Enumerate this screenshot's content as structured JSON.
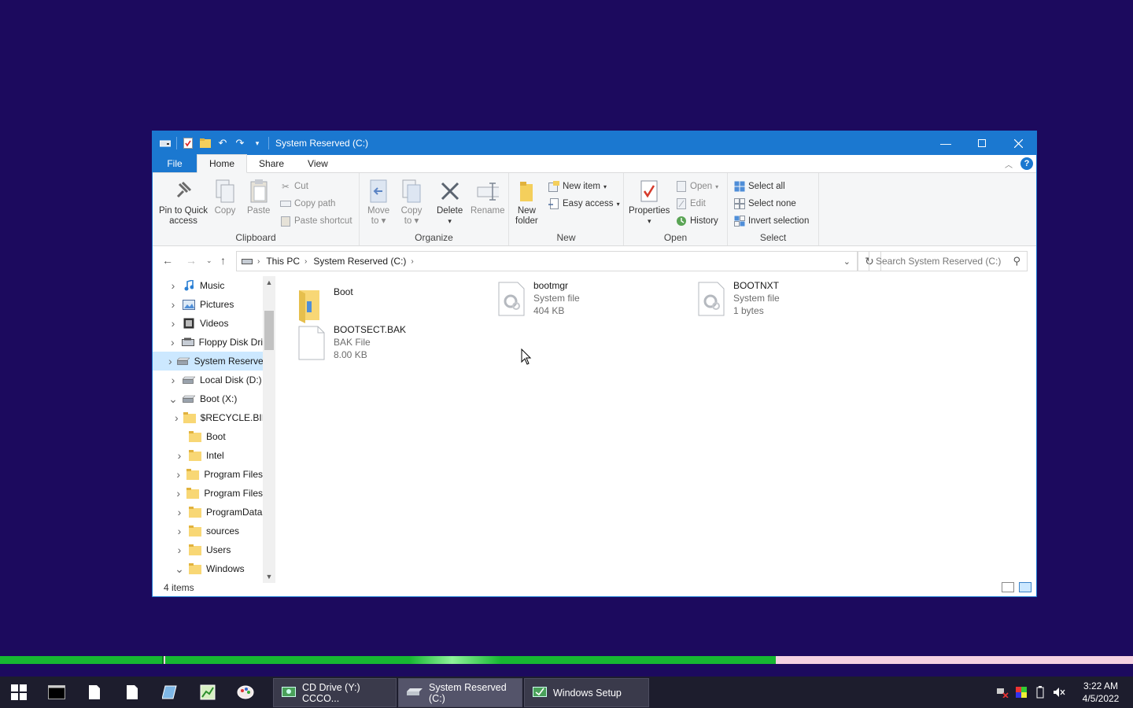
{
  "window": {
    "title": "System Reserved (C:)",
    "accent": "#1b78d0"
  },
  "tabs": [
    "File",
    "Home",
    "Share",
    "View"
  ],
  "ribbon": {
    "clipboard": {
      "label": "Clipboard",
      "pin": [
        "Pin to Quick",
        "access"
      ],
      "copy": "Copy",
      "paste": "Paste",
      "cut": "Cut",
      "copy_path": "Copy path",
      "paste_shortcut": "Paste shortcut"
    },
    "organize": {
      "label": "Organize",
      "move": [
        "Move",
        "to"
      ],
      "copy": [
        "Copy",
        "to"
      ],
      "delete": "Delete",
      "rename": "Rename"
    },
    "new": {
      "label": "New",
      "new_folder": [
        "New",
        "folder"
      ],
      "new_item": "New item",
      "easy_access": "Easy access"
    },
    "open": {
      "label": "Open",
      "properties": "Properties",
      "open": "Open",
      "edit": "Edit",
      "history": "History"
    },
    "select": {
      "label": "Select",
      "select_all": "Select all",
      "select_none": "Select none",
      "invert": "Invert selection"
    }
  },
  "address": {
    "crumbs": [
      "This PC",
      "System Reserved (C:)"
    ],
    "search_placeholder": "Search System Reserved (C:)"
  },
  "tree": [
    {
      "label": "Music",
      "icon": "music-icon",
      "indent": 0,
      "expander": ">"
    },
    {
      "label": "Pictures",
      "icon": "pictures-icon",
      "indent": 0,
      "expander": ">"
    },
    {
      "label": "Videos",
      "icon": "videos-icon",
      "indent": 0,
      "expander": ">"
    },
    {
      "label": "Floppy Disk Dri",
      "icon": "floppy-icon",
      "indent": 0,
      "expander": ">"
    },
    {
      "label": "System Reserve",
      "icon": "drive-icon",
      "indent": 0,
      "expander": ">",
      "selected": true
    },
    {
      "label": "Local Disk (D:)",
      "icon": "drive-icon",
      "indent": 0,
      "expander": ">"
    },
    {
      "label": "Boot (X:)",
      "icon": "drive-icon",
      "indent": 0,
      "expander": "v"
    },
    {
      "label": "$RECYCLE.BII",
      "icon": "folder-icon",
      "indent": 1,
      "expander": ">"
    },
    {
      "label": "Boot",
      "icon": "folder-icon",
      "indent": 1,
      "expander": ""
    },
    {
      "label": "Intel",
      "icon": "folder-icon",
      "indent": 1,
      "expander": ">"
    },
    {
      "label": "Program Files",
      "icon": "folder-icon",
      "indent": 1,
      "expander": ">"
    },
    {
      "label": "Program Files",
      "icon": "folder-icon",
      "indent": 1,
      "expander": ">"
    },
    {
      "label": "ProgramData",
      "icon": "folder-icon",
      "indent": 1,
      "expander": ">"
    },
    {
      "label": "sources",
      "icon": "folder-icon",
      "indent": 1,
      "expander": ">"
    },
    {
      "label": "Users",
      "icon": "folder-icon",
      "indent": 1,
      "expander": ">"
    },
    {
      "label": "Windows",
      "icon": "folder-icon",
      "indent": 1,
      "expander": "v"
    }
  ],
  "files": [
    {
      "name": "Boot",
      "type": "",
      "size": "",
      "icon": "folder-icon"
    },
    {
      "name": "bootmgr",
      "type": "System file",
      "size": "404 KB",
      "icon": "system-file-icon"
    },
    {
      "name": "BOOTNXT",
      "type": "System file",
      "size": "1 bytes",
      "icon": "system-file-icon"
    },
    {
      "name": "BOOTSECT.BAK",
      "type": "BAK File",
      "size": "8.00 KB",
      "icon": "blank-file-icon"
    }
  ],
  "status": {
    "items": "4 items"
  },
  "progress": {
    "fraction": 0.685
  },
  "taskbar": {
    "apps": [
      "CD Drive (Y:) CCCO...",
      "System Reserved (C:)",
      "Windows Setup"
    ],
    "time": "3:22 AM",
    "date": "4/5/2022"
  }
}
